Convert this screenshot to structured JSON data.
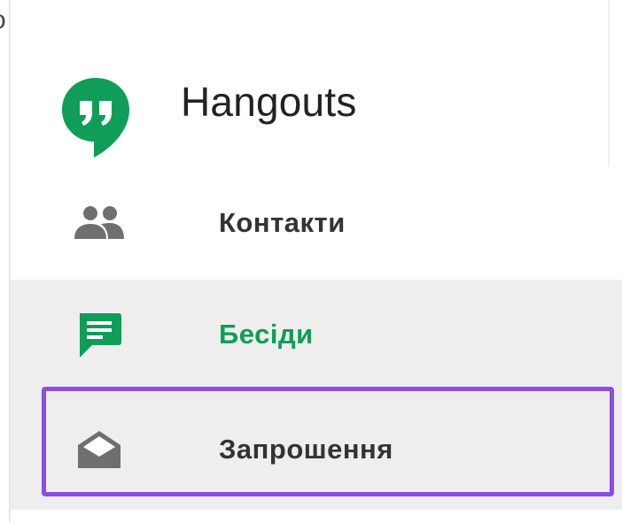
{
  "corner_glyph": "o",
  "header": {
    "title": "Hangouts",
    "logo_icon": "hangouts-logo-icon",
    "logo_color": "#0f9d58"
  },
  "nav": {
    "items": [
      {
        "label": "Контакти",
        "icon": "people-icon",
        "selected": false
      },
      {
        "label": "Бесіди",
        "icon": "chat-icon",
        "selected": true
      },
      {
        "label": "Запрошення",
        "icon": "envelope-open-icon",
        "selected": false
      }
    ]
  },
  "colors": {
    "accent_green": "#0f9d58",
    "selected_bg": "#eeeeee",
    "highlight_border": "#8a4ee6",
    "icon_gray": "#6f6f6f",
    "text": "#333333"
  }
}
